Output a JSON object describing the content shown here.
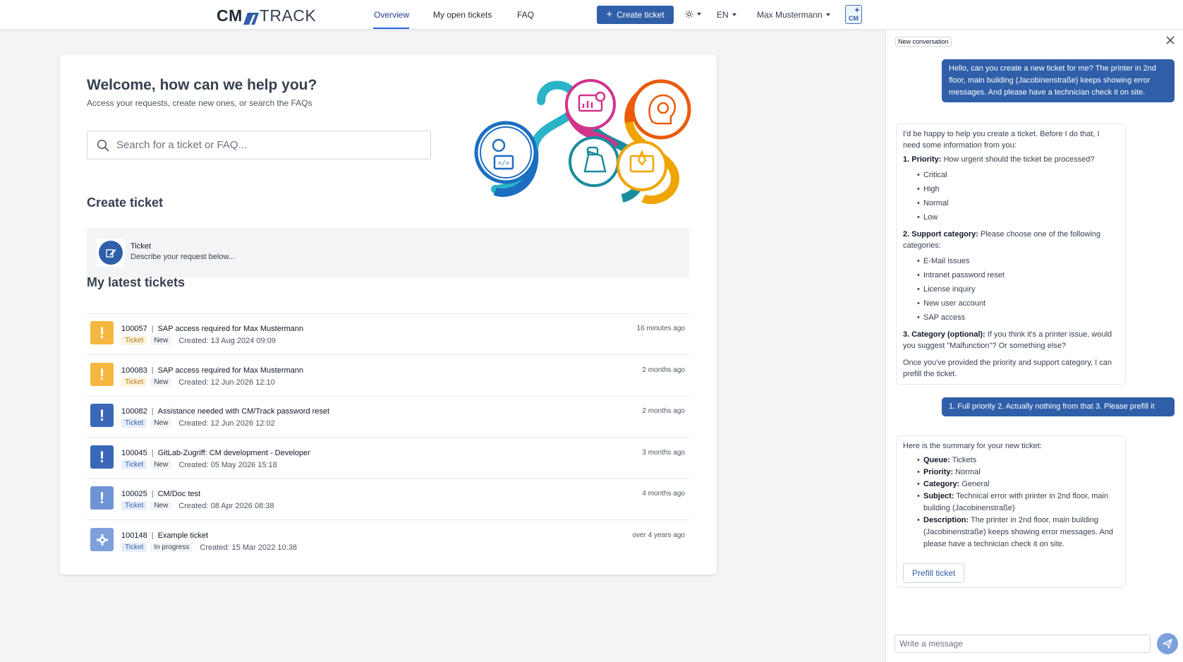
{
  "header": {
    "logo_left": "CM",
    "logo_right": "TRACK",
    "nav": [
      {
        "label": "Overview",
        "active": true
      },
      {
        "label": "My open tickets",
        "active": false
      },
      {
        "label": "FAQ",
        "active": false
      }
    ],
    "create_button": "Create ticket",
    "theme_icon": "sun-icon",
    "language": "EN",
    "user_name": "Max Mustermann",
    "assistant_badge": "CM"
  },
  "main": {
    "welcome_title": "Welcome, how can we help you?",
    "subtitle": "Access your requests, create new ones, or search the FAQs",
    "search_placeholder": "Search for a ticket or FAQ...",
    "create_section_title": "Create ticket",
    "create_option": {
      "title": "Ticket",
      "description": "Describe your request below..."
    },
    "latest_title": "My latest tickets",
    "tickets": [
      {
        "id": "100057",
        "subject": "SAP access required for Max Mustermann",
        "type": "Ticket",
        "status": "New",
        "created": "Created: 13 Aug 2024 09:09",
        "age": "16 minutes ago",
        "priority_icon": "exclamation-icon",
        "priority_color": "#f5b73f"
      },
      {
        "id": "100083",
        "subject": "SAP access required for Max Mustermann",
        "type": "Ticket",
        "status": "New",
        "created": "Created: 12 Jun 2026 12:10",
        "age": "2 months ago",
        "priority_icon": "exclamation-icon",
        "priority_color": "#f5b73f"
      },
      {
        "id": "100082",
        "subject": "Assistance needed with CM/Track password reset",
        "type": "Ticket",
        "status": "New",
        "created": "Created: 12 Jun 2026 12:02",
        "age": "2 months ago",
        "priority_icon": "exclamation-icon",
        "priority_color": "#3b67b8"
      },
      {
        "id": "100045",
        "subject": "GitLab-Zugriff: CM development - Developer",
        "type": "Ticket",
        "status": "New",
        "created": "Created: 05 May 2026 15:18",
        "age": "3 months ago",
        "priority_icon": "exclamation-icon",
        "priority_color": "#3b67b8"
      },
      {
        "id": "100025",
        "subject": "CM/Doc test",
        "type": "Ticket",
        "status": "New",
        "created": "Created: 08 Apr 2026 08:38",
        "age": "4 months ago",
        "priority_icon": "exclamation-icon",
        "priority_color": "#6f94d6"
      },
      {
        "id": "100148",
        "subject": "Example ticket",
        "type": "Ticket",
        "status": "In progress",
        "created": "Created: 15 Mar 2022 10:38",
        "age": "over 4 years ago",
        "priority_icon": "gear-icon",
        "priority_color": "#7ea0dc"
      }
    ]
  },
  "chat": {
    "conversation_label": "New conversation",
    "user_message_1": "Hello, can you create a new ticket for me? The printer in 2nd floor, main building (Jacobinenstraße) keeps showing error messages. And please have a technician check it on site.",
    "bot_reply_1": {
      "intro": "I'd be happy to help you create a ticket. Before I do that, I need some information from you:",
      "q1_label": "1. Priority:",
      "q1_text": "How urgent should the ticket be processed?",
      "priorities": [
        "Critical",
        "High",
        "Normal",
        "Low"
      ],
      "q2_label": "2. Support category:",
      "q2_text": "Please choose one of the following categories:",
      "categories": [
        "E-Mail issues",
        "Intranet password reset",
        "License inquiry",
        "New user account",
        "SAP access"
      ],
      "q3_label": "3. Category (optional):",
      "q3_text": "If you think it's a printer issue, would you suggest \"Malfunction\"? Or something else?",
      "outro": "Once you've provided the priority and support category, I can prefill the ticket."
    },
    "user_message_2": "1. Full priority 2. Actually nothing from that 3. Please prefill it",
    "bot_reply_2": {
      "intro": "Here is the summary for your new ticket:",
      "summary": [
        {
          "label": "Queue:",
          "value": "Tickets"
        },
        {
          "label": "Priority:",
          "value": "Normal"
        },
        {
          "label": "Category:",
          "value": "General"
        },
        {
          "label": "Subject:",
          "value": "Technical error with printer in 2nd floor, main building (Jacobinenstraße)"
        },
        {
          "label": "Description:",
          "value": "The printer in 2nd floor, main building (Jacobinenstraße) keeps showing error messages. And please have a technician check it on site."
        }
      ],
      "prefill_button": "Prefill ticket"
    },
    "input_placeholder": "Write a message"
  },
  "colors": {
    "brand_blue": "#2f5fa8",
    "priority_orange": "#f5b73f",
    "background": "#f3f4f6"
  }
}
